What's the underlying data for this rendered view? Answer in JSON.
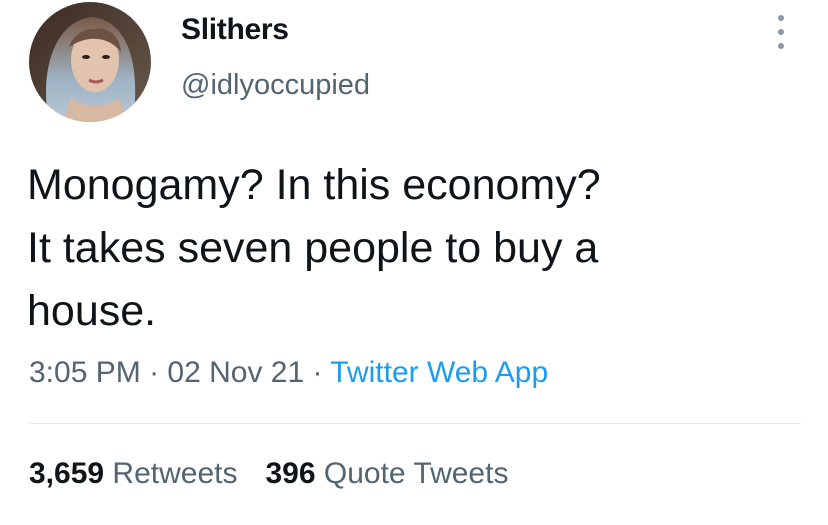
{
  "author": {
    "display_name": "Slithers",
    "handle": "@idlyoccupied",
    "avatar_icon": "profile-photo"
  },
  "tweet": {
    "lines": [
      "Monogamy? In this economy?",
      "It takes seven people to buy a",
      "house."
    ]
  },
  "meta": {
    "time": "3:05 PM",
    "separator": " · ",
    "date": "02 Nov 21",
    "source": "Twitter Web App"
  },
  "stats": {
    "retweets_count": "3,659",
    "retweets_label": "Retweets",
    "quotes_count": "396",
    "quotes_label": "Quote Tweets"
  },
  "colors": {
    "text": "#0f1419",
    "secondary": "#536471",
    "link": "#1d9bf0",
    "divider": "#e6ecf0"
  }
}
